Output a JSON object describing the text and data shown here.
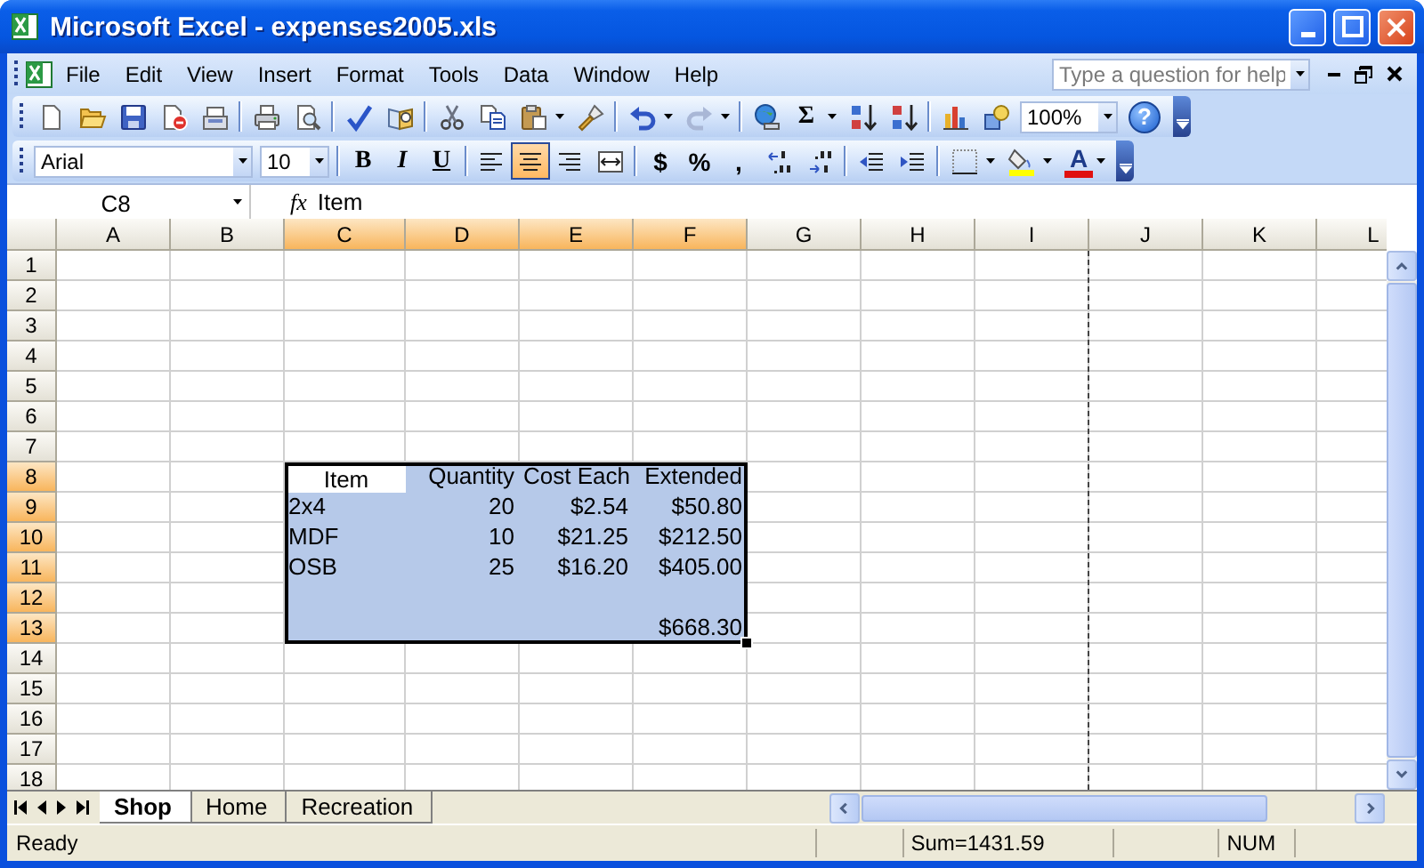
{
  "window": {
    "title": "Microsoft Excel - expenses2005.xls"
  },
  "menu": [
    {
      "label": "File"
    },
    {
      "label": "Edit"
    },
    {
      "label": "View"
    },
    {
      "label": "Insert"
    },
    {
      "label": "Format"
    },
    {
      "label": "Tools"
    },
    {
      "label": "Data"
    },
    {
      "label": "Window"
    },
    {
      "label": "Help"
    }
  ],
  "help_box": {
    "placeholder": "Type a question for help"
  },
  "standard_toolbar": {
    "autosum": "Σ",
    "zoom": "100%",
    "help": "?"
  },
  "formatting_toolbar": {
    "font": "Arial",
    "size": "10",
    "styles": [
      "B",
      "I",
      "U"
    ],
    "alignment": [
      {
        "selected": false
      },
      {
        "selected": true
      },
      {
        "selected": false
      }
    ],
    "number_formats": [
      "$",
      "%",
      ","
    ],
    "font_color": "A"
  },
  "formula_bar": {
    "name_box": "C8",
    "function_label": "fx",
    "content": "Item"
  },
  "sheet": {
    "columns": [
      {
        "label": "A",
        "selected": false,
        "page_break": false
      },
      {
        "label": "B",
        "selected": false,
        "page_break": false
      },
      {
        "label": "C",
        "selected": true,
        "page_break": false
      },
      {
        "label": "D",
        "selected": true,
        "page_break": false
      },
      {
        "label": "E",
        "selected": true,
        "page_break": false
      },
      {
        "label": "F",
        "selected": true,
        "page_break": false
      },
      {
        "label": "G",
        "selected": false,
        "page_break": false
      },
      {
        "label": "H",
        "selected": false,
        "page_break": false
      },
      {
        "label": "I",
        "selected": false,
        "page_break": true
      },
      {
        "label": "J",
        "selected": false,
        "page_break": false
      },
      {
        "label": "K",
        "selected": false,
        "page_break": false
      },
      {
        "label": "L",
        "selected": false,
        "page_break": false
      }
    ],
    "rows": [
      {
        "label": "1",
        "selected": false
      },
      {
        "label": "2",
        "selected": false
      },
      {
        "label": "3",
        "selected": false
      },
      {
        "label": "4",
        "selected": false
      },
      {
        "label": "5",
        "selected": false
      },
      {
        "label": "6",
        "selected": false
      },
      {
        "label": "7",
        "selected": false
      },
      {
        "label": "8",
        "selected": true,
        "cells": [
          {},
          {},
          {
            "kind": "centered",
            "text": "Item"
          },
          {
            "kind": "right",
            "text": "Quantity"
          },
          {
            "kind": "right",
            "text": "Cost Each"
          },
          {
            "kind": "right",
            "text": "Extended"
          }
        ]
      },
      {
        "label": "9",
        "selected": true,
        "cells": [
          {},
          {},
          {
            "kind": "left",
            "text": "2x4"
          },
          {
            "kind": "right",
            "text": "20"
          },
          {
            "kind": "right",
            "text": "$2.54"
          },
          {
            "kind": "right",
            "text": "$50.80"
          }
        ]
      },
      {
        "label": "10",
        "selected": true,
        "cells": [
          {},
          {},
          {
            "kind": "left",
            "text": "MDF"
          },
          {
            "kind": "right",
            "text": "10"
          },
          {
            "kind": "right",
            "text": "$21.25"
          },
          {
            "kind": "right",
            "text": "$212.50"
          }
        ]
      },
      {
        "label": "11",
        "selected": true,
        "cells": [
          {},
          {},
          {
            "kind": "left",
            "text": "OSB"
          },
          {
            "kind": "right",
            "text": "25"
          },
          {
            "kind": "right",
            "text": "$16.20"
          },
          {
            "kind": "right",
            "text": "$405.00"
          }
        ]
      },
      {
        "label": "12",
        "selected": true
      },
      {
        "label": "13",
        "selected": true,
        "cells": [
          {},
          {},
          {},
          {},
          {},
          {
            "kind": "right",
            "text": "$668.30"
          }
        ]
      },
      {
        "label": "14",
        "selected": false
      },
      {
        "label": "15",
        "selected": false
      },
      {
        "label": "16",
        "selected": false
      },
      {
        "label": "17",
        "selected": false
      },
      {
        "label": "18",
        "selected": false
      }
    ]
  },
  "sheet_tabs": [
    {
      "label": "Shop",
      "selected": true
    },
    {
      "label": "Home",
      "selected": false
    },
    {
      "label": "Recreation",
      "selected": false
    }
  ],
  "status_bar": {
    "mode": "Ready",
    "sum": "Sum=1431.59",
    "num_lock": "NUM"
  }
}
